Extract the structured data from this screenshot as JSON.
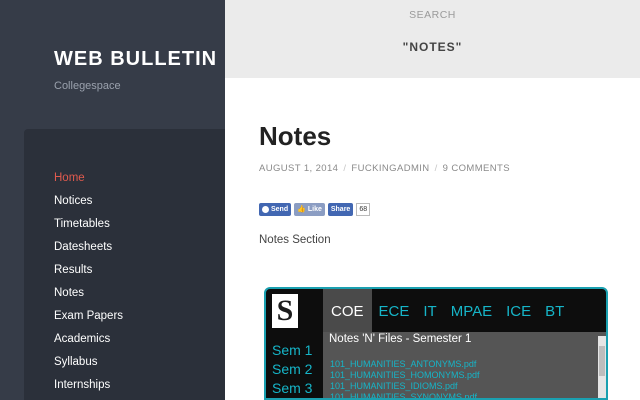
{
  "site": {
    "title": "WEB BULLETIN",
    "description": "Collegespace"
  },
  "nav": {
    "items": [
      {
        "label": "Home"
      },
      {
        "label": "Notices"
      },
      {
        "label": "Timetables"
      },
      {
        "label": "Datesheets"
      },
      {
        "label": "Results"
      },
      {
        "label": "Notes"
      },
      {
        "label": "Exam Papers"
      },
      {
        "label": "Academics"
      },
      {
        "label": "Syllabus"
      },
      {
        "label": "Internships"
      }
    ],
    "active": "Home",
    "active_color": "#e05a4e"
  },
  "search": {
    "label": "SEARCH",
    "query": "\"NOTES\""
  },
  "post": {
    "title": "Notes",
    "date": "AUGUST 1, 2014",
    "author": "FUCKINGADMIN",
    "comments": "9 COMMENTS",
    "section_text": "Notes Section"
  },
  "social": {
    "send_label": "Send",
    "like_label": "Like",
    "share_label": "Share",
    "share_count": "68"
  },
  "embed": {
    "logo_letter": "S",
    "tabs": [
      "COE",
      "ECE",
      "IT",
      "MPAE",
      "ICE",
      "BT"
    ],
    "active_tab": "COE",
    "semesters": [
      "Sem 1",
      "Sem 2",
      "Sem 3"
    ],
    "files_title": "Notes 'N' Files - Semester 1",
    "files": [
      "101_HUMANITIES_ANTONYMS.pdf",
      "101_HUMANITIES_HOMONYMS.pdf",
      "101_HUMANITIES_IDIOMS.pdf",
      "101_HUMANITIES_SYNONYMS.pdf"
    ],
    "accent_color": "#16b5c8"
  }
}
